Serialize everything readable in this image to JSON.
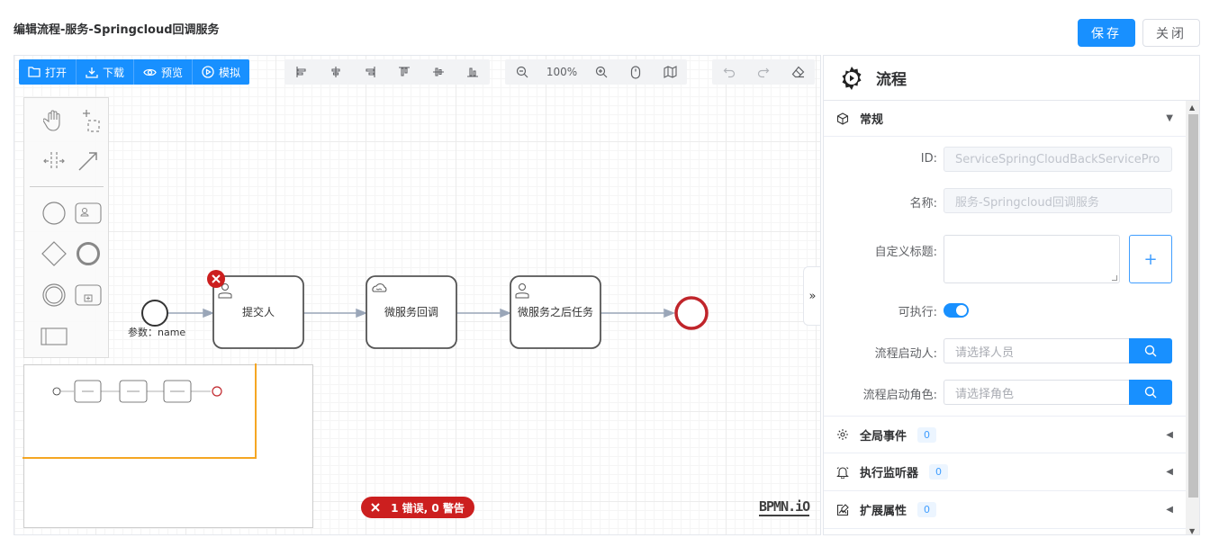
{
  "header": {
    "title": "编辑流程-服务-Springcloud回调服务",
    "save_label": "保存",
    "close_label": "关闭"
  },
  "toolbar": {
    "open": "打开",
    "download": "下载",
    "preview": "预览",
    "simulate": "模拟",
    "zoom": "100%"
  },
  "diagram": {
    "start_label": "参数：name",
    "tasks": [
      "提交人",
      "微服务回调",
      "微服务之后任务"
    ]
  },
  "status": {
    "errors": "1 错误, 0 警告",
    "logo": "BPMN.iO"
  },
  "panel": {
    "title": "流程",
    "general": {
      "title": "常规",
      "id_label": "ID:",
      "id_value": "ServiceSpringCloudBackServicePro",
      "name_label": "名称:",
      "name_value": "服务-Springcloud回调服务",
      "custom_title_label": "自定义标题:",
      "executable_label": "可执行:",
      "executable": true,
      "starter_label": "流程启动人:",
      "starter_placeholder": "请选择人员",
      "starter_role_label": "流程启动角色:",
      "starter_role_placeholder": "请选择角色"
    },
    "sections": [
      {
        "title": "全局事件",
        "count": "0"
      },
      {
        "title": "执行监听器",
        "count": "0"
      },
      {
        "title": "扩展属性",
        "count": "0"
      }
    ]
  },
  "colors": {
    "primary": "#1890ff",
    "error": "#cc1f1f",
    "end_event": "#c0252b",
    "minimap_viewport": "#f5a623"
  }
}
